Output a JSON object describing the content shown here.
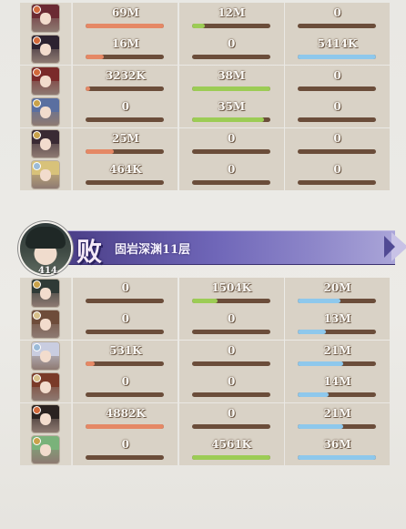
{
  "team_top": {
    "rows": [
      {
        "portrait": {
          "hair": "#6b2a33",
          "badge": "#d2693a"
        },
        "damage": {
          "label": "69M",
          "fill": 1.0
        },
        "tank": {
          "label": "12M",
          "fill": 0.17
        },
        "heal": {
          "label": "0",
          "fill": 0
        }
      },
      {
        "portrait": {
          "hair": "#2c2230",
          "badge": "#d2693a"
        },
        "damage": {
          "label": "16M",
          "fill": 0.23
        },
        "tank": {
          "label": "0",
          "fill": 0
        },
        "heal": {
          "label": "5414K",
          "fill": 1.0
        }
      },
      {
        "portrait": {
          "hair": "#7a2a2a",
          "badge": "#d2693a"
        },
        "damage": {
          "label": "3232K",
          "fill": 0.05
        },
        "tank": {
          "label": "38M",
          "fill": 1.0
        },
        "heal": {
          "label": "0",
          "fill": 0
        }
      },
      {
        "portrait": {
          "hair": "#5a6fa0",
          "badge": "#c9a24a"
        },
        "damage": {
          "label": "0",
          "fill": 0
        },
        "tank": {
          "label": "35M",
          "fill": 0.92
        },
        "heal": {
          "label": "0",
          "fill": 0
        }
      },
      {
        "portrait": {
          "hair": "#3a2a33",
          "badge": "#c9a24a"
        },
        "damage": {
          "label": "25M",
          "fill": 0.36
        },
        "tank": {
          "label": "0",
          "fill": 0
        },
        "heal": {
          "label": "0",
          "fill": 0
        }
      },
      {
        "portrait": {
          "hair": "#d8c27a",
          "badge": "#9bbbd8"
        },
        "damage": {
          "label": "464K",
          "fill": 0
        },
        "tank": {
          "label": "0",
          "fill": 0
        },
        "heal": {
          "label": "0",
          "fill": 0
        }
      }
    ]
  },
  "team_header": {
    "result_char": "败",
    "stage": "固岩深渊11层",
    "avatar_level": "414"
  },
  "team_bottom": {
    "rows": [
      {
        "portrait": {
          "hair": "#2f3a36",
          "badge": "#c9a24a"
        },
        "damage": {
          "label": "0",
          "fill": 0
        },
        "tank": {
          "label": "1504K",
          "fill": 0.33
        },
        "heal": {
          "label": "20M",
          "fill": 0.55
        }
      },
      {
        "portrait": {
          "hair": "#6e4c3a",
          "badge": "#d8c08a"
        },
        "damage": {
          "label": "0",
          "fill": 0
        },
        "tank": {
          "label": "0",
          "fill": 0
        },
        "heal": {
          "label": "13M",
          "fill": 0.36
        }
      },
      {
        "portrait": {
          "hair": "#c9cde0",
          "badge": "#9bbbd8"
        },
        "damage": {
          "label": "531K",
          "fill": 0.11
        },
        "tank": {
          "label": "0",
          "fill": 0
        },
        "heal": {
          "label": "21M",
          "fill": 0.58
        }
      },
      {
        "portrait": {
          "hair": "#7a3a28",
          "badge": "#d8c08a"
        },
        "damage": {
          "label": "0",
          "fill": 0
        },
        "tank": {
          "label": "0",
          "fill": 0
        },
        "heal": {
          "label": "14M",
          "fill": 0.39
        }
      },
      {
        "portrait": {
          "hair": "#2a2220",
          "badge": "#d2693a"
        },
        "damage": {
          "label": "4882K",
          "fill": 1.0
        },
        "tank": {
          "label": "0",
          "fill": 0
        },
        "heal": {
          "label": "21M",
          "fill": 0.58
        }
      },
      {
        "portrait": {
          "hair": "#7ab27a",
          "badge": "#c9a24a"
        },
        "damage": {
          "label": "0",
          "fill": 0
        },
        "tank": {
          "label": "4561K",
          "fill": 1.0
        },
        "heal": {
          "label": "36M",
          "fill": 1.0
        }
      }
    ]
  }
}
